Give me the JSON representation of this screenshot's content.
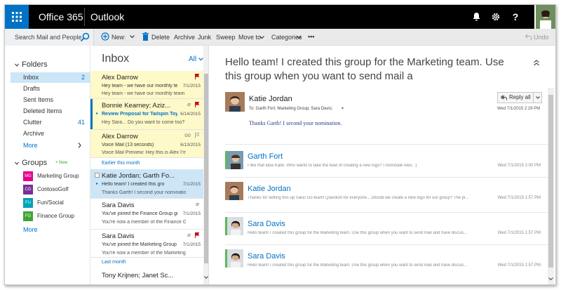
{
  "topbar": {
    "suite": "Office 365",
    "app": "Outlook",
    "icons": [
      "bell-icon",
      "gear-icon",
      "help-icon"
    ],
    "help_label": "?"
  },
  "command_bar": {
    "search_placeholder": "Search Mail and People",
    "new_label": "New",
    "delete_label": "Delete",
    "archive_label": "Archive",
    "junk_label": "Junk",
    "sweep_label": "Sweep",
    "moveto_label": "Move to",
    "categories_label": "Categories",
    "more_label": "•••",
    "undo_label": "Undo"
  },
  "folders": {
    "heading": "Folders",
    "items": [
      {
        "label": "Inbox",
        "count": "2"
      },
      {
        "label": "Drafts",
        "count": ""
      },
      {
        "label": "Sent Items",
        "count": ""
      },
      {
        "label": "Deleted Items",
        "count": ""
      },
      {
        "label": "Clutter",
        "count": "41"
      },
      {
        "label": "Archive",
        "count": ""
      }
    ],
    "more": "More"
  },
  "groups": {
    "heading": "Groups",
    "new_badge": "New",
    "items": [
      {
        "label": "Marketing Group",
        "initials": "MG",
        "color": "#e3008c"
      },
      {
        "label": "ContosoGolf",
        "initials": "CG",
        "color": "#7a2f95"
      },
      {
        "label": "Fun/Social",
        "initials": "FU",
        "color": "#00a2b5"
      },
      {
        "label": "Finance Group",
        "initials": "FG",
        "color": "#3fa535"
      }
    ],
    "more": "More"
  },
  "inbox": {
    "title": "Inbox",
    "filter": "All",
    "group_earlier": "Earlier this month",
    "group_last": "Last month",
    "messages": [
      {
        "from": "Alex Darrow",
        "subject": "Hey team - we have our monthly te",
        "date": "7/1/2015",
        "preview": "Hey team - we have our monthly team offsite"
      },
      {
        "from": "Bonnie Kearney; Aziz...",
        "subject": "Review Proposal for Tailspin Toys",
        "date": "6/14/2015",
        "preview": "Hey Sara... Do you want to come too? I will be"
      },
      {
        "from": "Alex Darrow",
        "subject": "Voice Mail (13 seconds)",
        "date": "6/13/2015",
        "preview": "Voice Mail Preview: Hey this is Alex I'm callin"
      },
      {
        "from": "Katie Jordan; Garth Fo...",
        "subject": "Hello team! I created this gro",
        "date": "7/1/2015",
        "preview": "Thanks Garth! I second your nomination."
      },
      {
        "from": "Sara Davis",
        "subject": "You've joined the Finance Group gr",
        "date": "7/1/2015",
        "preview": "You're now a member of the Finance Group."
      },
      {
        "from": "Sara Davis",
        "subject": "You've joined the Marketing Group",
        "date": "7/1/2015",
        "preview": "You're now a member of the Marketing Gr..."
      },
      {
        "from": "Tony Krijnen; Janet Sc...",
        "subject": "",
        "date": "",
        "preview": ""
      }
    ]
  },
  "reading": {
    "subject": "Hello team! I created this group for the Marketing team. Use this group when you want to send mail a",
    "sender": "Katie Jordan",
    "to_line": "To: Garth Fort; Marketing Group; Sara Davis;",
    "date": "Wed 7/1/2015 2:29 PM",
    "reply_all": "Reply all",
    "body": "Thanks Garth! I second your nomination.",
    "thread": [
      {
        "name": "Garth Fort",
        "preview": "I like that idea Katie. Who wants to take the lead of creating a new logo? I nominate Alex. :)",
        "date": "Wed 7/1/2015 2:00 PM"
      },
      {
        "name": "Katie Jordan",
        "preview": "Thanks for setting this up Sara! Go team! Question for everyone....should we create a new logo for our group? The pi...",
        "date": "Wed 7/1/2015 1:57 PM"
      },
      {
        "name": "Sara Davis",
        "preview": "Hello team! I created this group for the Marketing team. Use this group when you want to send mail and have discus...",
        "date": "Wed 7/1/2015 1:57 PM"
      },
      {
        "name": "Sara Davis",
        "preview": "Hello team! I created this group for the Marketing team. Use this group when you want to send mail and have discus...",
        "date": "Wed 7/1/2015 1:57 PM"
      }
    ]
  }
}
